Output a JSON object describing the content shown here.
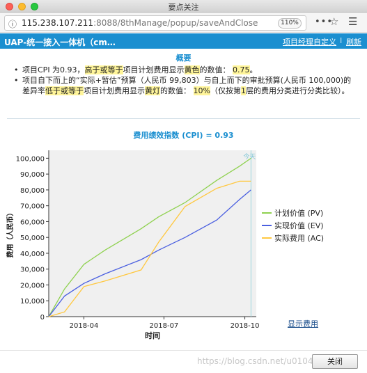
{
  "window": {
    "title": "要点关注"
  },
  "browser": {
    "url_host": "115.238.107.211",
    "url_rest": ":8088/8thManage/popup/saveAndClosePopup.do",
    "zoom": "110%"
  },
  "app": {
    "title": "UAP-统一接入一体机（cm…",
    "custom_link": "项目经理自定义",
    "separator": "I",
    "refresh_link": "刷新"
  },
  "summary": {
    "title": "概要",
    "b1_pre": "项目CPI 为0.93，",
    "b1_hl1": "高于或等于",
    "b1_mid": "项目计划费用显示",
    "b1_hl2": "黄色",
    "b1_post": "的数值：",
    "b1_value": "0.75",
    "b1_end": "。",
    "b2_pre": "项目自下而上的“实际+暂估”预算（人民币 99,803）与自上而下的审批预算(人民币 100,000)的差异率",
    "b2_hl1": "低于或等于",
    "b2_mid": "项目计划费用显示",
    "b2_hl2": "黄灯",
    "b2_post": "的数值：",
    "b2_value": "10%",
    "b2_mid2": "（仅按第",
    "b2_hl3": "1",
    "b2_end": "层的费用分类进行分类比较）。"
  },
  "chart_data": {
    "type": "line",
    "title": "费用绩效指数 (CPI) = 0.93",
    "xlabel": "时间",
    "ylabel": "费用（人民币）",
    "today_label": "今天",
    "ylim": [
      0,
      105000
    ],
    "yticks": [
      "0",
      "10,000",
      "20,000",
      "30,000",
      "40,000",
      "50,000",
      "60,000",
      "70,000",
      "80,000",
      "90,000",
      "100,000"
    ],
    "xticks": [
      "2018-04",
      "2018-07",
      "2018-10"
    ],
    "x": [
      "2018-02-20",
      "2018-03-10",
      "2018-04-01",
      "2018-04-25",
      "2018-06-05",
      "2018-06-25",
      "2018-07-25",
      "2018-08-30",
      "2018-09-25",
      "2018-10-08"
    ],
    "series": [
      {
        "name": "计划价值 (PV)",
        "color": "#8fd14f",
        "values": [
          0,
          17500,
          33000,
          42000,
          55500,
          63000,
          72000,
          86000,
          95000,
          100000
        ]
      },
      {
        "name": "实现价值 (EV)",
        "color": "#4a5fe0",
        "values": [
          0,
          13000,
          21000,
          27000,
          36000,
          42000,
          50000,
          61000,
          74000,
          80000
        ]
      },
      {
        "name": "实际费用 (AC)",
        "color": "#ffc840",
        "values": [
          0,
          3000,
          19000,
          22500,
          29500,
          47000,
          69500,
          81000,
          85500,
          85500
        ]
      }
    ],
    "legend_position": "right",
    "grid": false,
    "background": "#f0f0f0"
  },
  "show_cost_link": "显示费用",
  "footer": {
    "watermark": "https://blog.csdn.net/u010417597",
    "close_label": "关闭"
  }
}
